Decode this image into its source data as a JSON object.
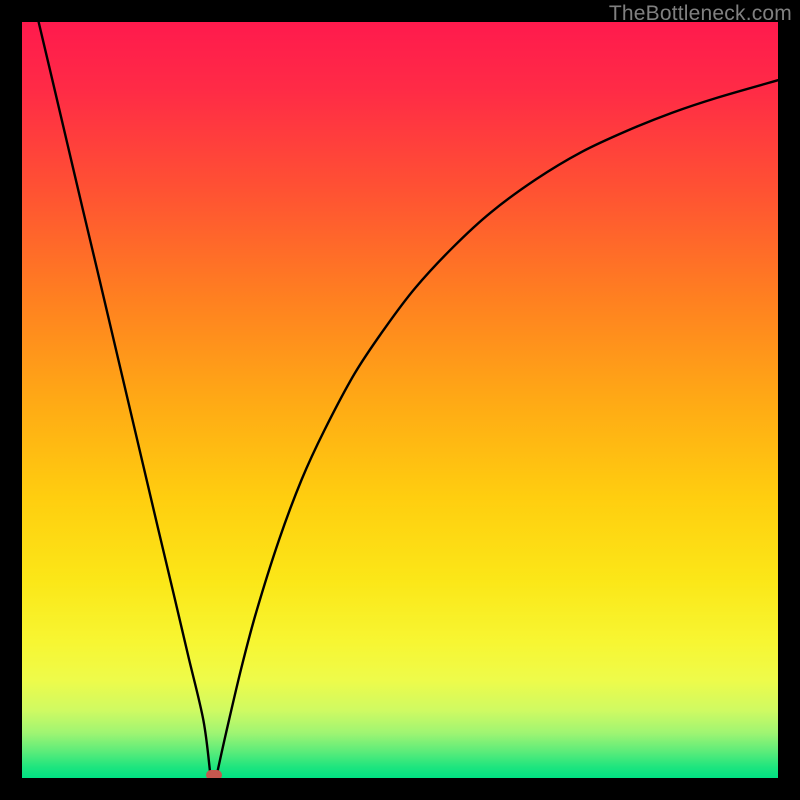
{
  "watermark": {
    "text": "TheBottleneck.com"
  },
  "chart_data": {
    "type": "line",
    "title": "",
    "xlabel": "",
    "ylabel": "",
    "xlim": [
      0,
      100
    ],
    "ylim": [
      0,
      100
    ],
    "grid": false,
    "gradient_stops": [
      {
        "offset": 0.0,
        "color": "#ff1a4d"
      },
      {
        "offset": 0.09,
        "color": "#ff2b46"
      },
      {
        "offset": 0.22,
        "color": "#ff5133"
      },
      {
        "offset": 0.36,
        "color": "#ff7e21"
      },
      {
        "offset": 0.5,
        "color": "#ffa915"
      },
      {
        "offset": 0.63,
        "color": "#ffce0f"
      },
      {
        "offset": 0.74,
        "color": "#fbe718"
      },
      {
        "offset": 0.82,
        "color": "#f7f632"
      },
      {
        "offset": 0.87,
        "color": "#eefb4a"
      },
      {
        "offset": 0.91,
        "color": "#d0fa62"
      },
      {
        "offset": 0.94,
        "color": "#a0f572"
      },
      {
        "offset": 0.965,
        "color": "#5cec7a"
      },
      {
        "offset": 0.985,
        "color": "#1fe57e"
      },
      {
        "offset": 1.0,
        "color": "#00e183"
      }
    ],
    "series": [
      {
        "name": "left-branch",
        "x": [
          2.2,
          4,
          6,
          8,
          10,
          12,
          14,
          16,
          18,
          20,
          22,
          24,
          24.9
        ],
        "y": [
          100,
          92.4,
          83.9,
          75.4,
          67.0,
          58.5,
          50.0,
          41.5,
          33.0,
          24.6,
          16.1,
          7.6,
          0.6
        ]
      },
      {
        "name": "right-branch",
        "x": [
          25.8,
          27,
          29,
          31,
          34,
          37,
          40,
          44,
          48,
          52,
          57,
          62,
          68,
          74,
          80,
          86,
          92,
          100
        ],
        "y": [
          0.6,
          6,
          14.5,
          22,
          31.5,
          39.5,
          46,
          53.5,
          59.5,
          64.8,
          70.2,
          74.8,
          79.2,
          82.8,
          85.6,
          88.0,
          90.0,
          92.3
        ]
      }
    ],
    "marker": {
      "x": 25.4,
      "y": 0.4,
      "color": "#c4584f"
    }
  }
}
